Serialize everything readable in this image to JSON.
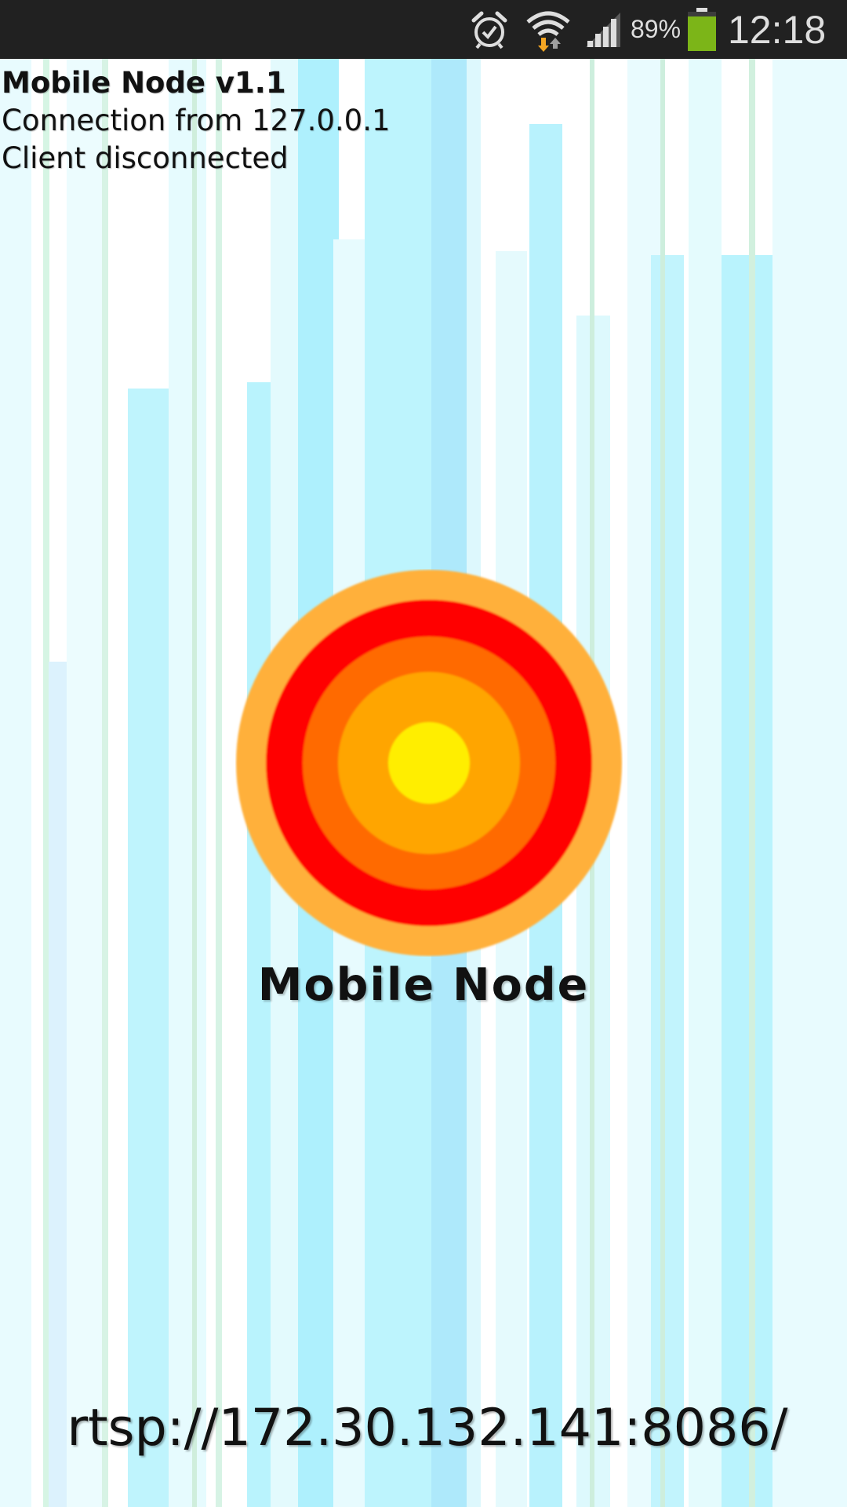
{
  "status_bar": {
    "battery_percent": "89%",
    "clock": "12:18",
    "icons": [
      "alarm-icon",
      "wifi-icon",
      "signal-icon",
      "battery-icon"
    ],
    "battery_color": "#7cb518"
  },
  "app": {
    "title": "Mobile Node v1.1",
    "log_lines": [
      "Connection from 127.0.0.1",
      "Client disconnected"
    ],
    "logo_text": "Mobile Node",
    "stream_url": "rtsp://172.30.132.141:8086/"
  },
  "colors": {
    "logo_outer": "#ffb03b",
    "logo_red": "#ff0000",
    "logo_orange": "#ff6a00",
    "logo_amber": "#ffa500",
    "logo_center": "#ffee00",
    "bar_cyan": "#b9f3fd",
    "bar_light": "#e3fafd"
  }
}
